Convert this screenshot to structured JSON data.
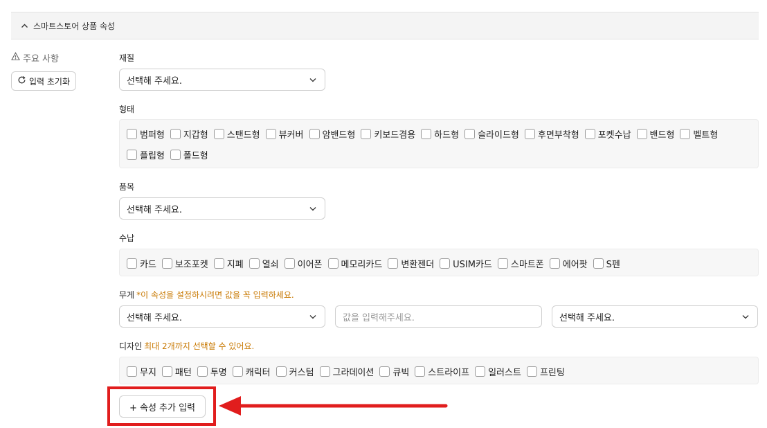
{
  "section": {
    "title": "스마트스토어 상품 속성"
  },
  "sidebar": {
    "notice_label": "주요 사항",
    "reset_label": "입력 초기화"
  },
  "fields": {
    "material": {
      "label": "재질",
      "placeholder": "선택해 주세요."
    },
    "shape": {
      "label": "형태",
      "options": [
        "범퍼형",
        "지갑형",
        "스탠드형",
        "뷰커버",
        "암밴드형",
        "키보드겸용",
        "하드형",
        "슬라이드형",
        "후면부착형",
        "포켓수납",
        "밴드형",
        "벨트형",
        "플립형",
        "폴드형"
      ]
    },
    "item": {
      "label": "품목",
      "placeholder": "선택해 주세요."
    },
    "storage": {
      "label": "수납",
      "options": [
        "카드",
        "보조포켓",
        "지폐",
        "열쇠",
        "이어폰",
        "메모리카드",
        "변환젠더",
        "USIM카드",
        "스마트폰",
        "에어팟",
        "S펜"
      ]
    },
    "weight": {
      "label": "무게",
      "hint": "*이 속성을 설정하시려면 값을 꼭 입력하세요.",
      "select_placeholder": "선택해 주세요.",
      "value_placeholder": "값을 입력해주세요.",
      "unit_placeholder": "선택해 주세요."
    },
    "design": {
      "label": "디자인",
      "hint": "최대 2개까지 선택할 수 있어요.",
      "options": [
        "무지",
        "패턴",
        "투명",
        "캐릭터",
        "커스텀",
        "그라데이션",
        "큐빅",
        "스트라이프",
        "일러스트",
        "프린팅"
      ]
    }
  },
  "actions": {
    "add_attribute_label": "+ 속성 추가 입력"
  },
  "colors": {
    "highlight": "#e11d1d",
    "hint": "#c87800",
    "panel_bg": "#f7f7f7"
  },
  "icons": [
    "chevron-up-icon",
    "warning-icon",
    "refresh-icon",
    "chevron-down-icon",
    "arrow-left-icon"
  ]
}
